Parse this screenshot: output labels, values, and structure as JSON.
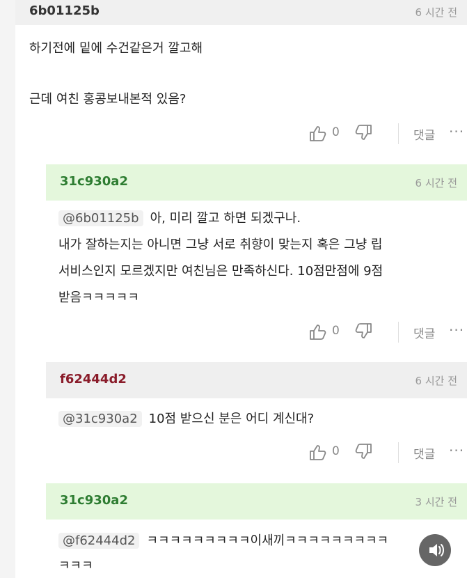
{
  "top_comment": {
    "user": "6b01125b",
    "time": "6 시간 전",
    "lines": [
      "하기전에 밑에 수건같은거 깔고해",
      "근데 여친 홍콩보내본적 있음?"
    ],
    "likes": "0",
    "reply_label": "댓글",
    "more": "···"
  },
  "replies": [
    {
      "user": "31c930a2",
      "time": "6 시간 전",
      "mention": "@6b01125b",
      "lines": [
        "아, 미리 깔고 하면 되겠구나.",
        "내가 잘하는지는 아니면 그냥 서로 취향이 맞는지 혹은 그냥 립",
        "서비스인지 모르겠지만 여친님은 만족하신다. 10점만점에 9점",
        "받음ㅋㅋㅋㅋㅋ"
      ],
      "likes": "0",
      "reply_label": "댓글",
      "more": "···"
    },
    {
      "user": "f62444d2",
      "time": "6 시간 전",
      "mention": "@31c930a2",
      "lines": [
        "10점 받으신 분은 어디 계신대?"
      ],
      "likes": "0",
      "reply_label": "댓글",
      "more": "···"
    },
    {
      "user": "31c930a2",
      "time": "3 시간 전",
      "mention": "@f62444d2",
      "lines": [
        "ㅋㅋㅋㅋㅋㅋㅋㅋㅋ이새끼ㅋㅋㅋㅋㅋㅋㅋㅋㅋ",
        "ㅋㅋㅋ"
      ]
    }
  ],
  "icons": {
    "thumb_up": "thumbs-up-icon",
    "thumb_down": "thumbs-down-icon",
    "sound": "speaker-icon"
  },
  "colors": {
    "green_header": "#e4f7dc",
    "gray_header": "#efefef",
    "green_user": "#2e7d32",
    "red_user": "#8a1c2a"
  }
}
